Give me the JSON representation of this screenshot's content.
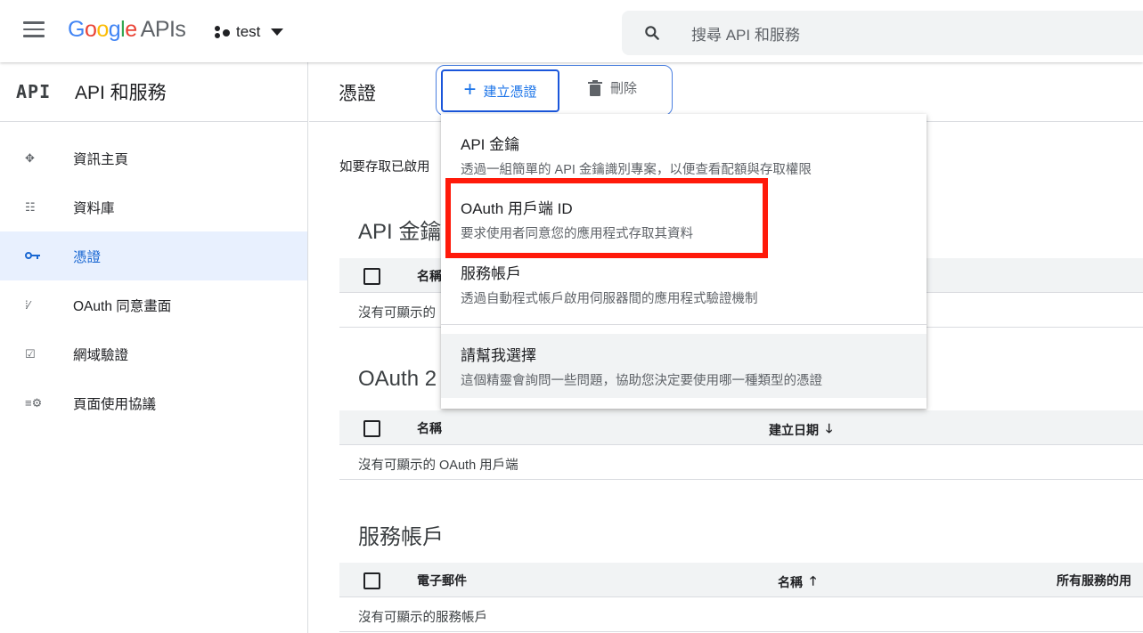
{
  "header": {
    "logo_google": "Google",
    "logo_apis": "APIs",
    "project": "test",
    "search_placeholder": "搜尋 API 和服務"
  },
  "sidebar": {
    "api_badge": "API",
    "title": "API 和服務",
    "items": [
      {
        "label": "資訊主頁",
        "icon": "dashboard-icon"
      },
      {
        "label": "資料庫",
        "icon": "library-icon"
      },
      {
        "label": "憑證",
        "icon": "key-icon",
        "active": true
      },
      {
        "label": "OAuth 同意畫面",
        "icon": "consent-icon"
      },
      {
        "label": "網域驗證",
        "icon": "checkbox-icon"
      },
      {
        "label": "頁面使用協議",
        "icon": "settings-list-icon"
      }
    ]
  },
  "main": {
    "title": "憑證",
    "create_label": "建立憑證",
    "delete_label": "刪除",
    "intro": "如要存取已啟用",
    "sections": [
      {
        "title": "API 金鑰",
        "col1": "名稱",
        "empty": "沒有可顯示的"
      },
      {
        "title": "OAuth 2",
        "col1": "名稱",
        "col2": "建立日期",
        "empty": "沒有可顯示的 OAuth 用戶端"
      },
      {
        "title": "服務帳戶",
        "col1": "電子郵件",
        "col2": "名稱",
        "col3": "所有服務的用",
        "empty": "沒有可顯示的服務帳戶"
      }
    ]
  },
  "dropdown": {
    "items": [
      {
        "title": "API 金鑰",
        "desc": "透過一組簡單的 API 金鑰識別專案，以便查看配額與存取權限"
      },
      {
        "title": "OAuth 用戶端 ID",
        "desc": "要求使用者同意您的應用程式存取其資料"
      },
      {
        "title": "服務帳戶",
        "desc": "透過自動程式帳戶啟用伺服器間的應用程式驗證機制"
      },
      {
        "title": "請幫我選擇",
        "desc": "這個精靈會詢問一些問題，協助您決定要使用哪一種類型的憑證"
      }
    ]
  },
  "colors": {
    "accent": "#1a73e8",
    "highlight": "#ff1a0a",
    "active_bg": "#e8f0fe"
  }
}
